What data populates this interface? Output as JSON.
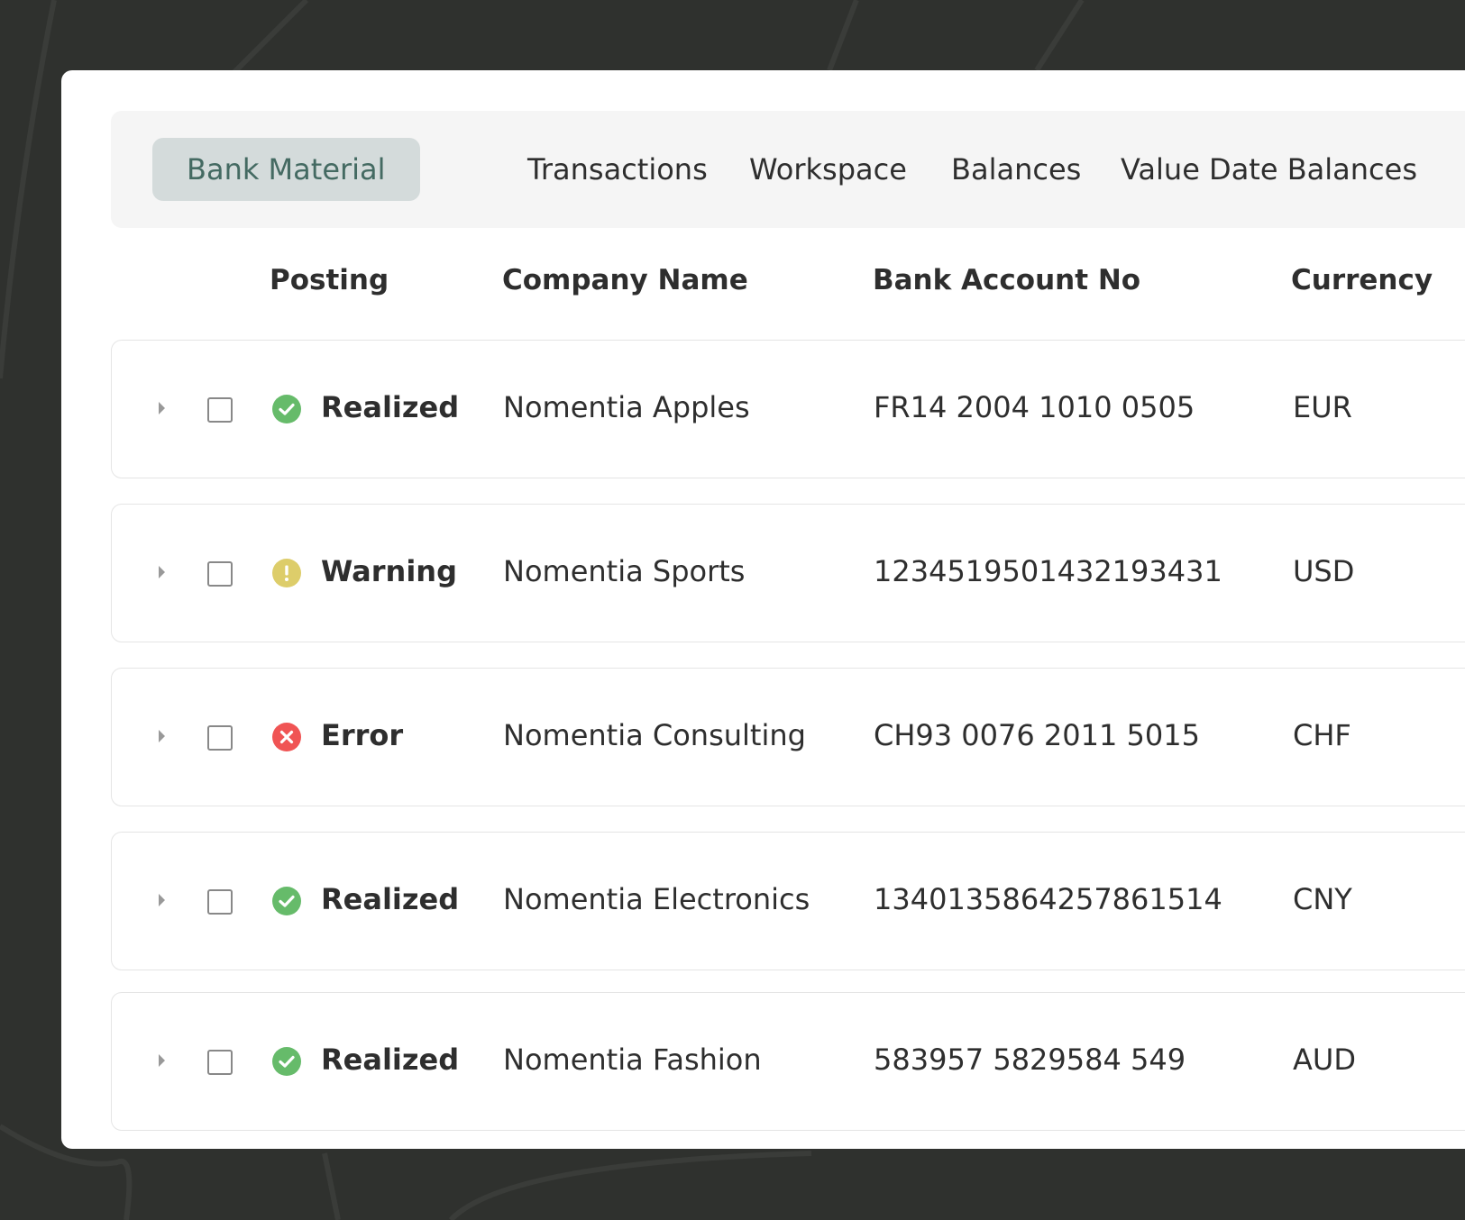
{
  "tabs": [
    {
      "label": "Bank Material",
      "active": true
    },
    {
      "label": "Transactions",
      "active": false
    },
    {
      "label": "Workspace",
      "active": false
    },
    {
      "label": "Balances",
      "active": false
    },
    {
      "label": "Value Date Balances",
      "active": false
    }
  ],
  "columns": {
    "posting": "Posting",
    "company_name": "Company Name",
    "bank_account_no": "Bank Account No",
    "currency": "Currency"
  },
  "status_colors": {
    "realized": "#66bb6a",
    "warning": "#ddcd6a",
    "error": "#f05454"
  },
  "rows": [
    {
      "status": "Realized",
      "status_icon": "check-circle-icon",
      "company": "Nomentia Apples",
      "account": "FR14 2004 1010 0505",
      "currency": "EUR"
    },
    {
      "status": "Warning",
      "status_icon": "warning-circle-icon",
      "company": "Nomentia Sports",
      "account": "12345195014321934З1",
      "currency": "USD"
    },
    {
      "status": "Error",
      "status_icon": "error-circle-icon",
      "company": "Nomentia Consulting",
      "account": "CH93 0076 2011 5015",
      "currency": "CHF"
    },
    {
      "status": "Realized",
      "status_icon": "check-circle-icon",
      "company": "Nomentia Electronics",
      "account": "134013586425786151​4",
      "currency": "CNY"
    },
    {
      "status": "Realized",
      "status_icon": "check-circle-icon",
      "company": "Nomentia Fashion",
      "account": "583957 5829584 549",
      "currency": "AUD"
    }
  ]
}
